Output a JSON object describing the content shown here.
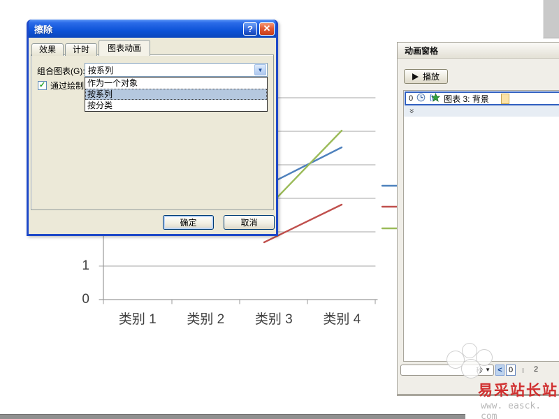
{
  "dialog": {
    "title": "擦除",
    "help_button": "?",
    "close_button": "✕",
    "tabs": [
      {
        "label": "效果"
      },
      {
        "label": "计时"
      },
      {
        "label": "图表动画"
      }
    ],
    "combo_label": "组合图表(G):",
    "combo_value": "按系列",
    "combo_arrow": "▼",
    "checkbox_label": "通过绘制图",
    "checkbox_checked": "✓",
    "dropdown_options": [
      {
        "label": "作为一个对象"
      },
      {
        "label": "按系列"
      },
      {
        "label": "按分类"
      }
    ],
    "selected_option": "按系列",
    "ok_button": "确定",
    "cancel_button": "取消"
  },
  "animation_pane": {
    "title": "动画窗格",
    "play_button": "播放",
    "item": {
      "order": "0",
      "label": "图表 3: 背景"
    },
    "expand_chevron": "«",
    "timeline": {
      "unit": "秒",
      "unit_caret": "▼",
      "scroll_left": "<",
      "current": "0",
      "tick_label": "2"
    }
  },
  "chart_data": {
    "type": "line",
    "categories": [
      "类别 1",
      "类别 2",
      "类别 3",
      "类别 4"
    ],
    "visible_ytick_labels": [
      "1",
      "0"
    ],
    "ylim_visible": [
      0,
      1
    ],
    "grid": true,
    "legend": "none-visible",
    "series": [
      {
        "name": "series-blue",
        "color": "#4E81BD"
      },
      {
        "name": "series-green",
        "color": "#9BBB59"
      },
      {
        "name": "series-red",
        "color": "#C0504D"
      }
    ]
  },
  "watermark": {
    "brand": "易采站长站",
    "url": "www. easck. com"
  }
}
